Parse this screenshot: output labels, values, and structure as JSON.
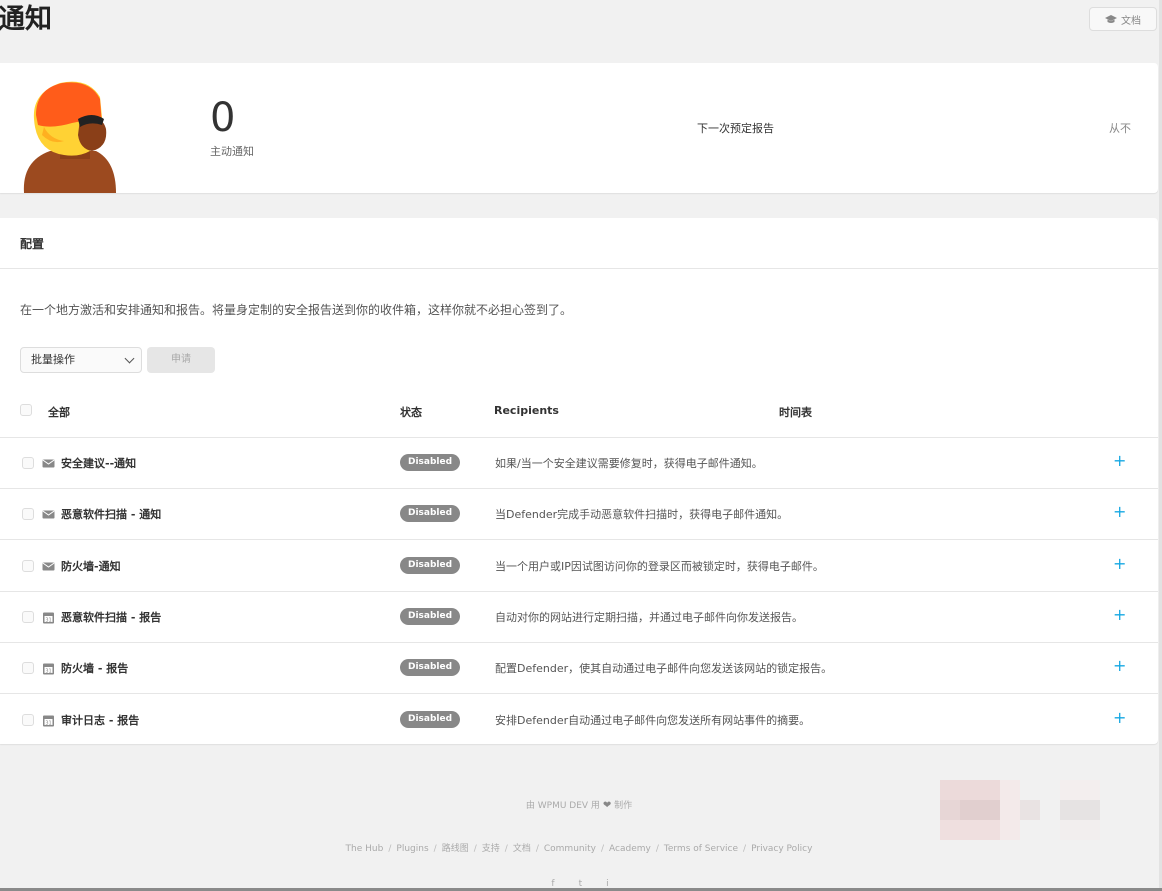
{
  "page": {
    "title": "通知",
    "doc_button_label": "文档"
  },
  "summary": {
    "active_count": "0",
    "active_label": "主动通知",
    "next_report_label": "下一次预定报告",
    "next_report_value": "从不"
  },
  "config": {
    "title": "配置",
    "description": "在一个地方激活和安排通知和报告。将量身定制的安全报告送到你的收件箱，这样你就不必担心签到了。",
    "bulk_select_value": "批量操作",
    "apply_label": "申请",
    "columns": {
      "all": "全部",
      "status": "状态",
      "recipients": "Recipients",
      "schedule": "时间表"
    },
    "rows": [
      {
        "name": "安全建议--通知",
        "icon": "envelope-icon",
        "status": "Disabled",
        "description": "如果/当一个安全建议需要修复时，获得电子邮件通知。"
      },
      {
        "name": "恶意软件扫描 - 通知",
        "icon": "envelope-icon",
        "status": "Disabled",
        "description": "当Defender完成手动恶意软件扫描时，获得电子邮件通知。"
      },
      {
        "name": "防火墙-通知",
        "icon": "envelope-icon",
        "status": "Disabled",
        "description": "当一个用户或IP因试图访问你的登录区而被锁定时，获得电子邮件。"
      },
      {
        "name": "恶意软件扫描 - 报告",
        "icon": "calendar-icon",
        "status": "Disabled",
        "description": "自动对你的网站进行定期扫描，并通过电子邮件向你发送报告。"
      },
      {
        "name": "防火墙 - 报告",
        "icon": "calendar-icon",
        "status": "Disabled",
        "description": "配置Defender，使其自动通过电子邮件向您发送该网站的锁定报告。"
      },
      {
        "name": "审计日志 - 报告",
        "icon": "calendar-icon",
        "status": "Disabled",
        "description": "安排Defender自动通过电子邮件向您发送所有网站事件的摘要。"
      }
    ],
    "add_label": "+"
  },
  "footer": {
    "made_prefix": "由 WPMU DEV 用",
    "made_suffix": "制作",
    "links": [
      "The Hub",
      "Plugins",
      "路线图",
      "支持",
      "文档",
      "Community",
      "Academy",
      "Terms of Service",
      "Privacy Policy"
    ],
    "link_separator": "/",
    "socials": [
      "f",
      "t",
      "i"
    ]
  },
  "colors": {
    "accent": "#17a8e3",
    "badge_disabled": "#888888",
    "mascot_helmet": "#ff5c1a",
    "mascot_helmet_trim": "#ffd234",
    "mascot_skin": "#9c4a1f"
  }
}
